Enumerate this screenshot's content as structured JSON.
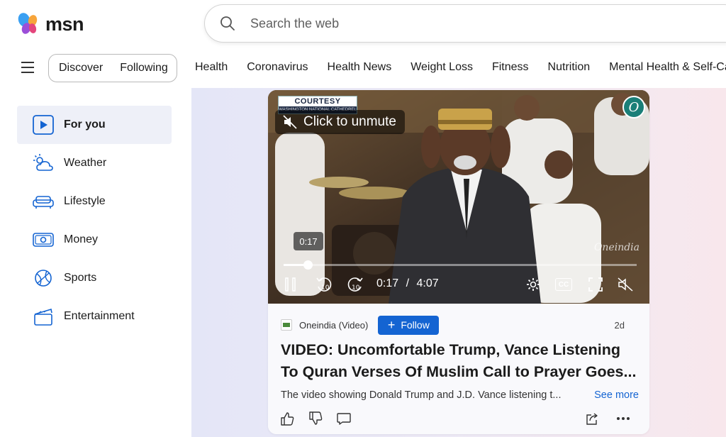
{
  "header": {
    "logo_text": "msn",
    "search_placeholder": "Search the web"
  },
  "nav": {
    "segments": [
      "Discover",
      "Following"
    ],
    "topics": [
      "Health",
      "Coronavirus",
      "Health News",
      "Weight Loss",
      "Fitness",
      "Nutrition",
      "Mental Health & Self-Care"
    ]
  },
  "sidebar": {
    "items": [
      {
        "label": "For you",
        "icon": "play-icon",
        "active": true
      },
      {
        "label": "Weather",
        "icon": "weather-icon"
      },
      {
        "label": "Lifestyle",
        "icon": "sofa-icon"
      },
      {
        "label": "Money",
        "icon": "money-icon"
      },
      {
        "label": "Sports",
        "icon": "sports-ball-icon"
      },
      {
        "label": "Entertainment",
        "icon": "clapperboard-icon"
      }
    ]
  },
  "card": {
    "video": {
      "courtesy_label": "COURTESY",
      "courtesy_sub": "WASHINGTON NATIONAL CATHEDREL",
      "unmute_label": "Click to unmute",
      "badge_letter": "O",
      "watermark": "Oneindia",
      "tooltip_time": "0:17",
      "current_time": "0:17",
      "separator": "/",
      "duration": "4:07",
      "progress_fraction": 0.069,
      "cc_label": "CC"
    },
    "source": "Oneindia (Video)",
    "follow_label": "Follow",
    "age": "2d",
    "headline": "VIDEO: Uncomfortable Trump, Vance Listening To Quran Verses Of Muslim Call to Prayer Goes...",
    "snippet": "The video showing Donald Trump and J.D. Vance listening t...",
    "see_more": "See more"
  },
  "colors": {
    "accent": "#1464d2",
    "sidebar_active": "#eef0f8"
  }
}
